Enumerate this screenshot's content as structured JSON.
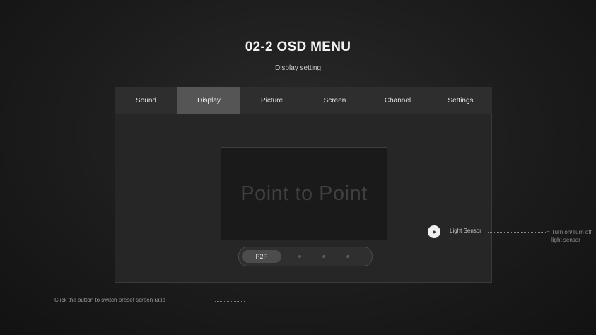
{
  "header": {
    "title": "02-2 OSD MENU",
    "subtitle": "Display setting"
  },
  "tabs": [
    {
      "label": "Sound"
    },
    {
      "label": "Display"
    },
    {
      "label": "Picture"
    },
    {
      "label": "Screen"
    },
    {
      "label": "Channel"
    },
    {
      "label": "Settings"
    }
  ],
  "active_tab": "Display",
  "preview": {
    "text": "Point to Point"
  },
  "selector": {
    "selected_label": "P2P"
  },
  "light_sensor": {
    "button_icon": "light-sensor-toggle-icon",
    "label": "Light Sensor",
    "annotation": "Turn on/Turn off light sensor"
  },
  "bottom_annotation": "Click the button to switch preset screen ratio"
}
